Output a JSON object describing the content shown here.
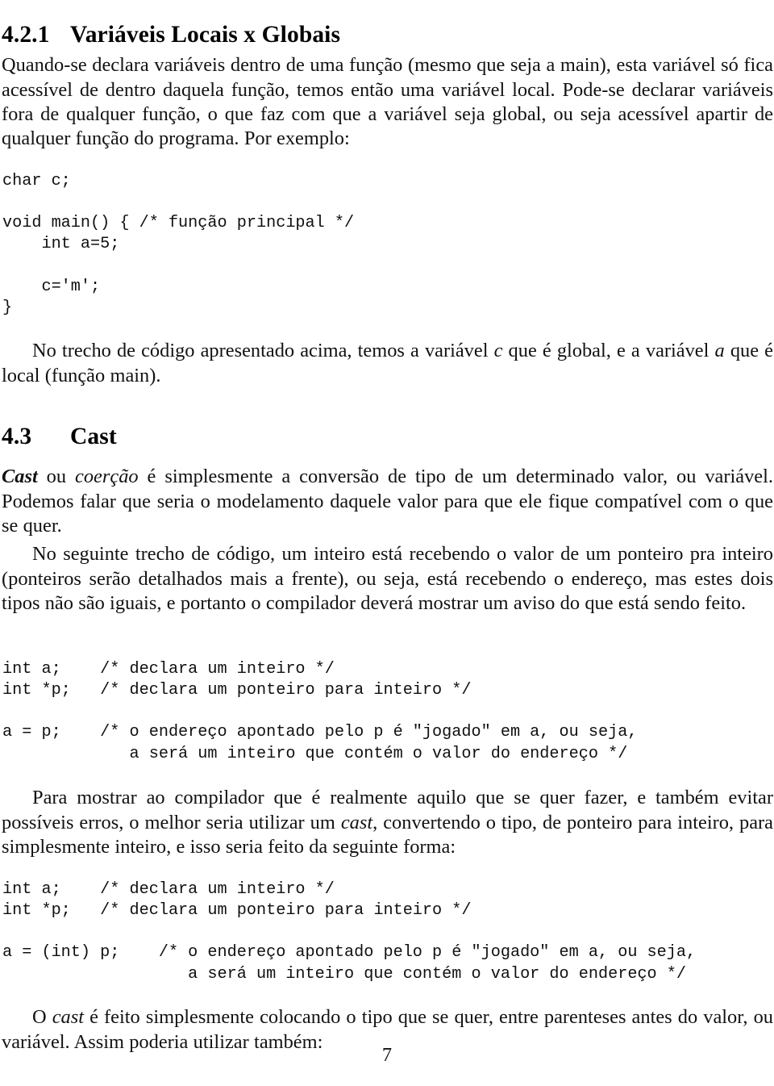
{
  "document": {
    "page_number": "7",
    "language": "pt-BR"
  },
  "sections": {
    "locais_globais": {
      "number": "4.2.1",
      "title": "Variáveis Locais x Globais"
    },
    "cast": {
      "number": "4.3",
      "title": "Cast"
    }
  },
  "paragraphs": {
    "p1_a": "Quando-se declara variáveis dentro de uma função (mesmo que seja a main), esta variável só fica acessível de dentro daquela função, temos então uma variável local. Pode-se declarar variáveis fora de qualquer função, o que faz com que a variável seja global, ou seja acessível apartir de qualquer função do programa. Por exemplo:",
    "p2_a": "No trecho de código apresentado acima, temos a variável ",
    "p2_var_c": "c",
    "p2_b": " que é global, e a variável ",
    "p2_var_a": "a",
    "p2_c": " que é local (função main).",
    "p3_cast": "Cast",
    "p3_a": " ou ",
    "p3_coercao": "coerção",
    "p3_b": " é simplesmente a conversão de tipo de um determinado valor, ou variável. Podemos falar que seria o modelamento daquele valor para que ele fique compatível com o que se quer.",
    "p4_a": "No seguinte trecho de código, um inteiro está recebendo o valor de um ponteiro pra inteiro (ponteiros serão detalhados mais a frente), ou seja, está recebendo o endereço, mas estes dois tipos não são iguais, e portanto o compilador deverá mostrar um aviso do que está sendo feito.",
    "p5_a": "Para mostrar ao compilador que é realmente aquilo que se quer fazer, e também evitar possíveis erros, o melhor seria utilizar um ",
    "p5_cast": "cast",
    "p5_b": ", convertendo o tipo, de ponteiro para inteiro, para simplesmente inteiro, e isso seria feito da seguinte forma:",
    "p6_a": "O ",
    "p6_cast": "cast",
    "p6_b": " é feito simplesmente colocando o tipo que se quer, entre parenteses antes do valor, ou variável. Assim poderia utilizar também:"
  },
  "code_blocks": {
    "block1": "char c;\n\nvoid main() { /* função principal */\n    int a=5;\n\n    c='m';\n}",
    "block2": "int a;    /* declara um inteiro */\nint *p;   /* declara um ponteiro para inteiro */\n\na = p;    /* o endereço apontado pelo p é \"jogado\" em a, ou seja,\n             a será um inteiro que contém o valor do endereço */",
    "block3": "int a;    /* declara um inteiro */\nint *p;   /* declara um ponteiro para inteiro */\n\na = (int) p;    /* o endereço apontado pelo p é \"jogado\" em a, ou seja,\n                   a será um inteiro que contém o valor do endereço */"
  },
  "colors": {
    "page_background": "#ffffff",
    "body_text": "#121212",
    "heading_text": "#000000",
    "code_text": "#101010"
  }
}
